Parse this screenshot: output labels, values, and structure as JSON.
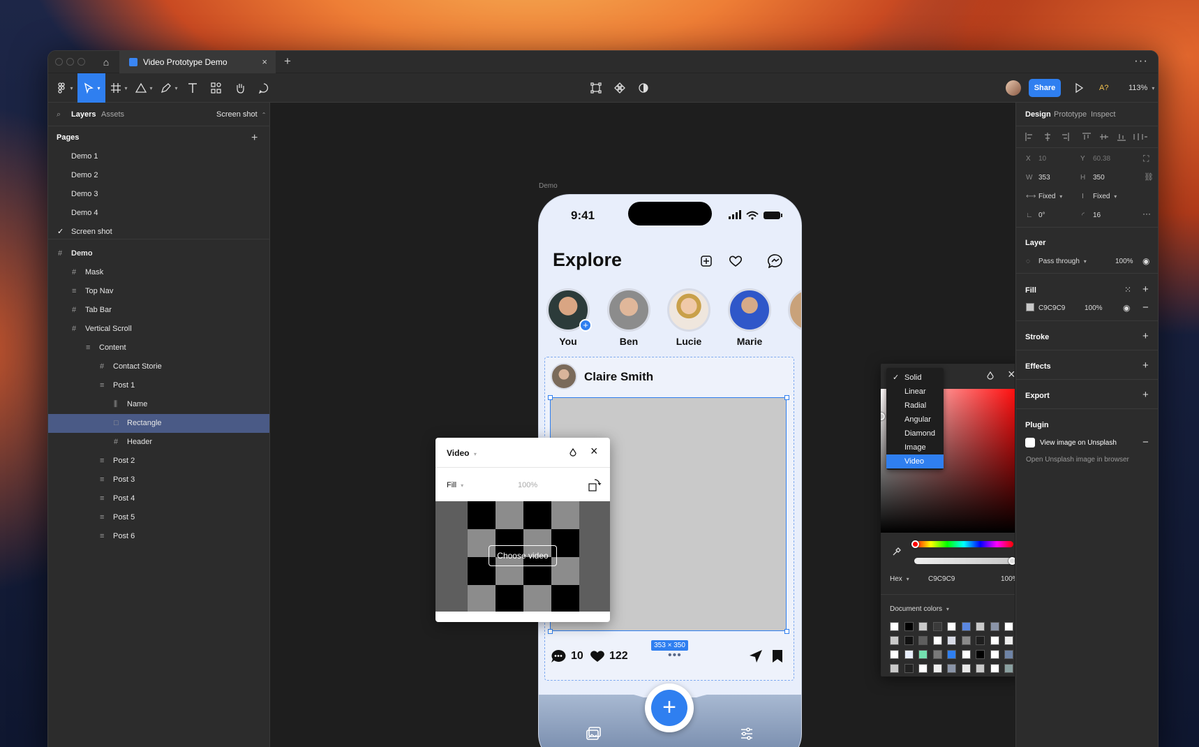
{
  "window": {
    "tab_title": "Video Prototype Demo"
  },
  "toolbar": {
    "share_label": "Share",
    "aa_label": "A?",
    "zoom": "113%"
  },
  "left_panel": {
    "tabs": {
      "layers": "Layers",
      "assets": "Assets",
      "page_selector": "Screen shot"
    },
    "pages_title": "Pages",
    "pages": [
      "Demo 1",
      "Demo 2",
      "Demo 3",
      "Demo 4",
      "Screen shot"
    ],
    "layers": [
      {
        "label": "Demo",
        "icon": "#",
        "depth": 0
      },
      {
        "label": "Mask",
        "icon": "#",
        "depth": 1
      },
      {
        "label": "Top Nav",
        "icon": "≡",
        "depth": 1
      },
      {
        "label": "Tab Bar",
        "icon": "#",
        "depth": 1
      },
      {
        "label": "Vertical Scroll",
        "icon": "#",
        "depth": 1
      },
      {
        "label": "Content",
        "icon": "≡",
        "depth": 2
      },
      {
        "label": "Contact Storie",
        "icon": "#",
        "depth": 3
      },
      {
        "label": "Post 1",
        "icon": "≡",
        "depth": 3
      },
      {
        "label": "Name",
        "icon": "⫼",
        "depth": 4
      },
      {
        "label": "Rectangle",
        "icon": "□",
        "depth": 4
      },
      {
        "label": "Header",
        "icon": "#",
        "depth": 4
      },
      {
        "label": "Post 2",
        "icon": "≡",
        "depth": 3
      },
      {
        "label": "Post 3",
        "icon": "≡",
        "depth": 3
      },
      {
        "label": "Post 4",
        "icon": "≡",
        "depth": 3
      },
      {
        "label": "Post 5",
        "icon": "≡",
        "depth": 3
      },
      {
        "label": "Post 6",
        "icon": "≡",
        "depth": 3
      }
    ]
  },
  "canvas": {
    "frame_label": "Demo",
    "phone": {
      "time": "9:41",
      "title": "Explore",
      "stories": [
        "You",
        "Ben",
        "Lucie",
        "Marie"
      ],
      "post_author": "Claire Smith",
      "dimensions": "353 × 350",
      "comments": "10",
      "likes": "122"
    },
    "video_popup": {
      "title": "Video",
      "fill_label": "Fill",
      "opacity": "100%",
      "choose_label": "Choose video"
    },
    "color_popup": {
      "menu": [
        "Solid",
        "Linear",
        "Radial",
        "Angular",
        "Diamond",
        "Image",
        "Video"
      ],
      "hex_label": "Hex",
      "hex_value": "C9C9C9",
      "opacity": "100%",
      "doc_colors_label": "Document colors",
      "swatches": [
        "#ffffff",
        "#000000",
        "#c9c9c9",
        "#3a3a3a",
        "#ffffff",
        "#5b87e0",
        "#c9c9c9",
        "#8a94a8",
        "#ffffff",
        "#c9c9c9",
        "#111111",
        "#5e5e5e",
        "#ffffff",
        "#d7dbe6",
        "#8a8a8a",
        "#1e1e1e",
        "#ffffff",
        "#eeeeee",
        "#ffffff",
        "#e8eefb",
        "#74e0b0",
        "#7a7a7a",
        "#2f7ff0",
        "#ffffff",
        "#000000",
        "#ffffff",
        "#6f84a6",
        "#c9c9c9",
        "#222222",
        "#ffffff",
        "#eeeeee",
        "#8a94a8",
        "#e8e8e8",
        "#c9c9c9",
        "#ffffff",
        "#8aa0a0"
      ]
    }
  },
  "right_panel": {
    "tabs": [
      "Design",
      "Prototype",
      "Inspect"
    ],
    "x_label": "X",
    "x": "10",
    "y_label": "Y",
    "y": "60.38",
    "w_label": "W",
    "w": "353",
    "h_label": "H",
    "h": "350",
    "w_mode": "Fixed",
    "h_mode": "Fixed",
    "rotation": "0°",
    "radius": "16",
    "layer_title": "Layer",
    "blend": "Pass through",
    "layer_opacity": "100%",
    "fill_title": "Fill",
    "fill_hex": "C9C9C9",
    "fill_opacity": "100%",
    "stroke_title": "Stroke",
    "effects_title": "Effects",
    "export_title": "Export",
    "plugin_title": "Plugin",
    "plugin_name": "View image on Unsplash",
    "plugin_desc": "Open Unsplash image in browser"
  },
  "colors": {
    "accent": "#2f7ff0",
    "selection": "#4a5a86",
    "panel": "#2c2c2c",
    "fill": "#c9c9c9"
  }
}
